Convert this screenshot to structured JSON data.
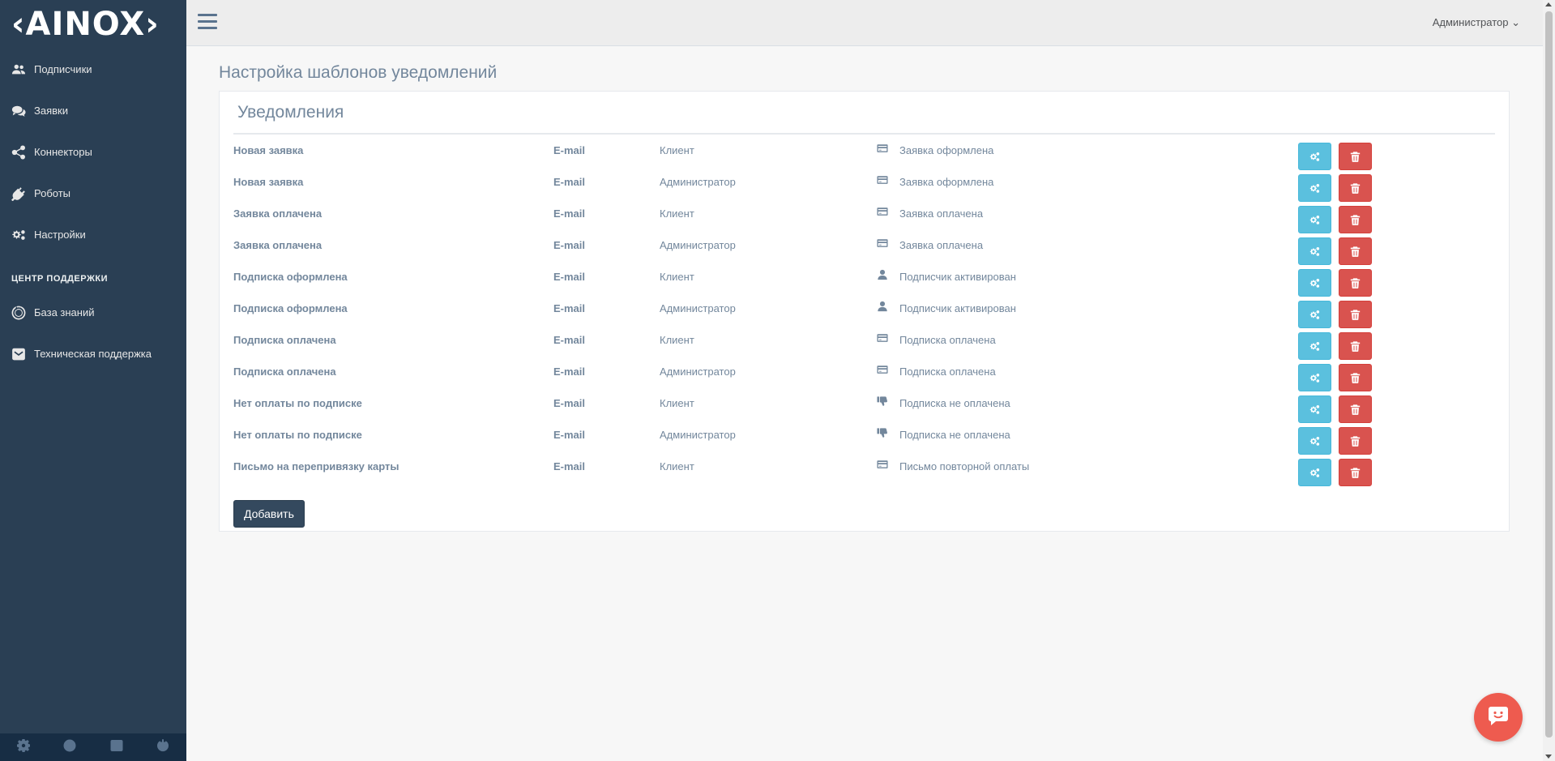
{
  "app": {
    "logo": "‹AINOX›"
  },
  "sidebar": {
    "items": [
      {
        "label": "Подписчики",
        "icon": "users-icon"
      },
      {
        "label": "Заявки",
        "icon": "comments-icon"
      },
      {
        "label": "Коннекторы",
        "icon": "share-icon"
      },
      {
        "label": "Роботы",
        "icon": "plug-icon"
      },
      {
        "label": "Настройки",
        "icon": "cogs-icon"
      }
    ],
    "support_title": "ЦЕНТР ПОДДЕРЖКИ",
    "support_items": [
      {
        "label": "База знаний",
        "icon": "life-ring-icon"
      },
      {
        "label": "Техническая поддержка",
        "icon": "envelope-icon"
      }
    ],
    "footer_icons": [
      "gear-icon",
      "life-ring-icon",
      "window-icon",
      "power-icon"
    ]
  },
  "topbar": {
    "user": "Администратор ⌄"
  },
  "page": {
    "title": "Настройка шаблонов уведомлений"
  },
  "panel": {
    "title": "Уведомления",
    "rows": [
      {
        "name": "Новая заявка",
        "channel": "E-mail",
        "recipient": "Клиент",
        "event": "Заявка оформлена",
        "event_icon": "credit-card-icon"
      },
      {
        "name": "Новая заявка",
        "channel": "E-mail",
        "recipient": "Администратор",
        "event": "Заявка оформлена",
        "event_icon": "credit-card-icon"
      },
      {
        "name": "Заявка оплачена",
        "channel": "E-mail",
        "recipient": "Клиент",
        "event": "Заявка оплачена",
        "event_icon": "credit-card-icon"
      },
      {
        "name": "Заявка оплачена",
        "channel": "E-mail",
        "recipient": "Администратор",
        "event": "Заявка оплачена",
        "event_icon": "credit-card-icon"
      },
      {
        "name": "Подписка оформлена",
        "channel": "E-mail",
        "recipient": "Клиент",
        "event": "Подписчик активирован",
        "event_icon": "user-icon"
      },
      {
        "name": "Подписка оформлена",
        "channel": "E-mail",
        "recipient": "Администратор",
        "event": "Подписчик активирован",
        "event_icon": "user-icon"
      },
      {
        "name": "Подписка оплачена",
        "channel": "E-mail",
        "recipient": "Клиент",
        "event": "Подписка оплачена",
        "event_icon": "credit-card-icon"
      },
      {
        "name": "Подписка оплачена",
        "channel": "E-mail",
        "recipient": "Администратор",
        "event": "Подписка оплачена",
        "event_icon": "credit-card-icon"
      },
      {
        "name": "Нет оплаты по подписке",
        "channel": "E-mail",
        "recipient": "Клиент",
        "event": "Подписка не оплачена",
        "event_icon": "thumbs-down-icon"
      },
      {
        "name": "Нет оплаты по подписке",
        "channel": "E-mail",
        "recipient": "Администратор",
        "event": "Подписка не оплачена",
        "event_icon": "thumbs-down-icon"
      },
      {
        "name": "Письмо на перепривязку карты",
        "channel": "E-mail",
        "recipient": "Клиент",
        "event": "Письмо повторной оплаты",
        "event_icon": "credit-card-icon"
      }
    ],
    "add_label": "Добавить"
  },
  "colors": {
    "sidebar_bg": "#2a3f54",
    "edit_button": "#5bc0de",
    "delete_button": "#d9534f",
    "add_button": "#34495e",
    "chat_bubble": "#ee5b4f"
  }
}
